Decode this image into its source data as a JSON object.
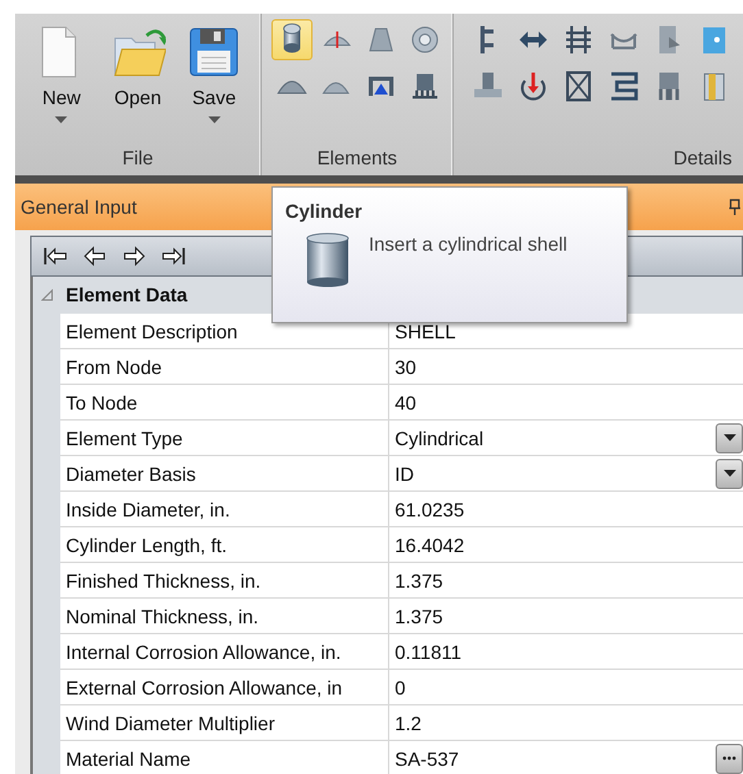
{
  "ribbon": {
    "groups": [
      {
        "kind": "large",
        "label": "File",
        "buttons": [
          {
            "label": "New",
            "dropdown": true
          },
          {
            "label": "Open",
            "dropdown": false
          },
          {
            "label": "Save",
            "dropdown": true
          }
        ]
      },
      {
        "kind": "tools",
        "label": "Elements",
        "tools": [
          {
            "selected": true
          },
          {
            "selected": false
          },
          {
            "selected": false
          },
          {
            "selected": false
          },
          {
            "selected": false
          },
          {
            "selected": false
          },
          {
            "selected": false
          },
          {
            "selected": false
          }
        ]
      },
      {
        "kind": "details",
        "label": "Details"
      }
    ]
  },
  "panel": {
    "title": "General Input"
  },
  "tooltip": {
    "title": "Cylinder",
    "text": "Insert a cylindrical shell"
  },
  "grid": {
    "category": {
      "title": "Element Data",
      "expanded": true
    },
    "rows": [
      {
        "label": "Element Description",
        "value": "SHELL",
        "kind": "text"
      },
      {
        "label": "From Node",
        "value": "30",
        "kind": "text"
      },
      {
        "label": "To Node",
        "value": "40",
        "kind": "text"
      },
      {
        "label": "Element Type",
        "value": "Cylindrical",
        "kind": "dropdown"
      },
      {
        "label": "Diameter Basis",
        "value": "ID",
        "kind": "dropdown"
      },
      {
        "label": "Inside Diameter, in.",
        "value": "61.0235",
        "kind": "text"
      },
      {
        "label": "Cylinder Length, ft.",
        "value": "16.4042",
        "kind": "text"
      },
      {
        "label": "Finished Thickness, in.",
        "value": "1.375",
        "kind": "text"
      },
      {
        "label": "Nominal Thickness, in.",
        "value": "1.375",
        "kind": "text"
      },
      {
        "label": "Internal Corrosion Allowance, in.",
        "value": "0.11811",
        "kind": "text"
      },
      {
        "label": "External Corrosion Allowance, in",
        "value": "0",
        "kind": "text"
      },
      {
        "label": "Wind Diameter Multiplier",
        "value": "1.2",
        "kind": "text"
      },
      {
        "label": "Material Name",
        "value": "SA-537",
        "kind": "browse"
      }
    ]
  }
}
